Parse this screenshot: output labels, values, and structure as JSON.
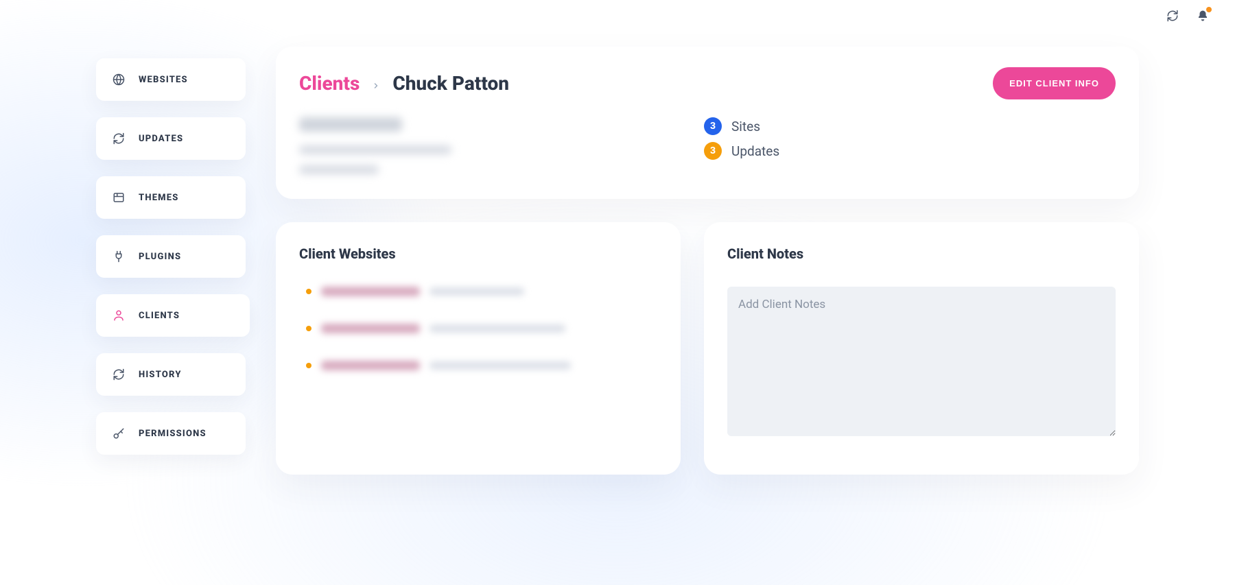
{
  "header": {
    "breadcrumb_root": "Clients",
    "breadcrumb_current": "Chuck Patton",
    "edit_button": "EDIT CLIENT INFO"
  },
  "sidebar": {
    "items": [
      {
        "label": "WEBSITES",
        "icon": "globe-icon",
        "active": false
      },
      {
        "label": "UPDATES",
        "icon": "refresh-icon",
        "active": false
      },
      {
        "label": "THEMES",
        "icon": "panel-icon",
        "active": false
      },
      {
        "label": "PLUGINS",
        "icon": "plug-icon",
        "active": false
      },
      {
        "label": "CLIENTS",
        "icon": "user-icon",
        "active": true
      },
      {
        "label": "HISTORY",
        "icon": "refresh-icon",
        "active": false
      },
      {
        "label": "PERMISSIONS",
        "icon": "key-icon",
        "active": false
      }
    ]
  },
  "stats": {
    "sites": {
      "count": "3",
      "label": "Sites"
    },
    "updates": {
      "count": "3",
      "label": "Updates"
    }
  },
  "panels": {
    "websites_title": "Client Websites",
    "notes_title": "Client Notes",
    "notes_placeholder": "Add Client Notes"
  },
  "colors": {
    "accent": "#ec4899",
    "badge_sites": "#2463eb",
    "badge_updates": "#f59e0b"
  }
}
